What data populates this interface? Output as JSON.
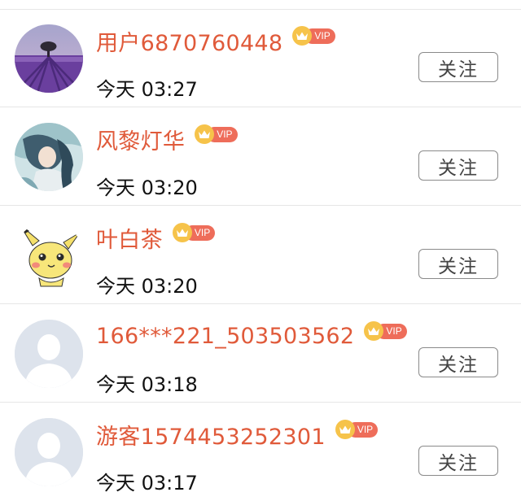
{
  "follow_label": "关注",
  "vip_label": "VIP",
  "colors": {
    "name": "#e05a3a",
    "vip_crown": "#f6c34a",
    "vip_tag": "#ee6d5a"
  },
  "users": [
    {
      "name": "用户6870760448",
      "time": "今天 03:27",
      "avatar": "lavender-field-photo",
      "vip": true
    },
    {
      "name": "风黎灯华",
      "time": "今天 03:20",
      "avatar": "anime-character-art",
      "vip": true
    },
    {
      "name": "叶白茶",
      "time": "今天 03:20",
      "avatar": "pikachu-cartoon",
      "vip": true
    },
    {
      "name": "166***221_503503562",
      "time": "今天 03:18",
      "avatar": "default-person-avatar",
      "vip": true
    },
    {
      "name": "游客1574453252301",
      "time": "今天 03:17",
      "avatar": "default-person-avatar",
      "vip": true
    }
  ]
}
